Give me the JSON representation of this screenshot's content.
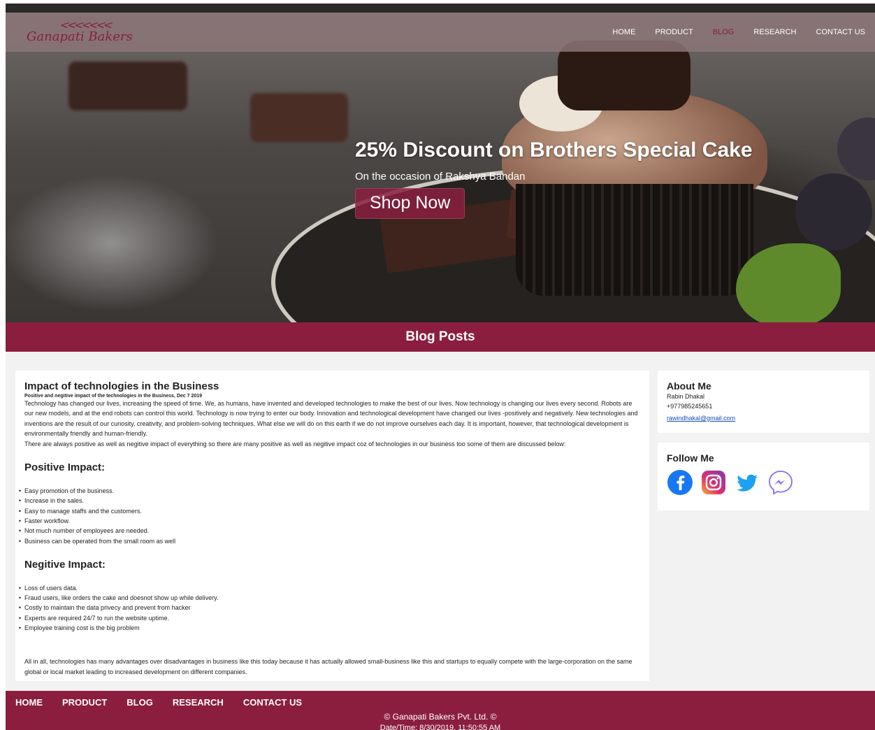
{
  "brand": {
    "name": "Ganapati Bakers",
    "color": "#8b1e3f"
  },
  "nav": {
    "items": [
      {
        "label": "HOME"
      },
      {
        "label": "PRODUCT"
      },
      {
        "label": "BLOG",
        "active": true
      },
      {
        "label": "RESEARCH"
      },
      {
        "label": "CONTACT US"
      }
    ]
  },
  "hero": {
    "title": "25% Discount on Brothers Special Cake",
    "subtitle": "On the occasion of Rakshya Bandan",
    "button": "Shop Now"
  },
  "banner": {
    "title": "Blog Posts"
  },
  "article": {
    "title": "Impact of technologies in the Business",
    "meta": "Positive and negitive impact of the technologies in the Business, Dec 7 2019",
    "intro": "Technology has changed our lives, increasing the speed of time. We, as humans, have invented and developed technologies to make the best of our lives. Now technology is changing our lives every second. Robots are our new models, and at the end robots can control this world. Technology is now trying to enter our body. Innovation and technological development have changed our lives -positively and negatively. New technologies and inventions are the result of our curiosity, creativity, and problem-solving techniques. What else we will do on this earth if we do not improve ourselves each day. It is important, however, that technological development is environmentally friendly and human-friendly.",
    "intro2": "There are always positive as well as negitive impact of everything so there are many positive as well as negitive impact coz of technologies in our business too some of them are discussed below:",
    "positive_heading": "Positive Impact:",
    "positive": [
      "Easy promotion of the business.",
      "Increase in the sales.",
      "Easy to manage staffs and the customers.",
      "Faster workflow.",
      "Not much number of employees are needed.",
      "Business can be operated from the small room as well"
    ],
    "negative_heading": "Negitive Impact:",
    "negative": [
      "Loss of users data.",
      "Fraud users, like orders the cake and doesnot show up while delivery.",
      "Costly to maintain the data privecy and prevent from hacker",
      "Experts are required 24/7 to run the website uptime.",
      "Employee training cost is the big problem"
    ],
    "conclusion": "All in all, technologies has many advantages over disadvantages in business like this today because it has actually allowed small-business like this and startups to equally compete with the large-corporation on the same global or local market leading to increased development on different companies."
  },
  "about": {
    "heading": "About Me",
    "name": "Rabin Dhakal",
    "phone": "+977985245651",
    "email": "rawindhakal@gmail.com"
  },
  "follow": {
    "heading": "Follow Me",
    "icons": [
      "facebook-icon",
      "instagram-icon",
      "twitter-icon",
      "messenger-icon"
    ]
  },
  "footer": {
    "nav": [
      "HOME",
      "PRODUCT",
      "BLOG",
      "RESEARCH",
      "CONTACT US"
    ],
    "copyright": "© Ganapati Bakers Pvt. Ltd. ©",
    "datetime": "Date/Time: 8/30/2019, 11:50:55 AM"
  }
}
